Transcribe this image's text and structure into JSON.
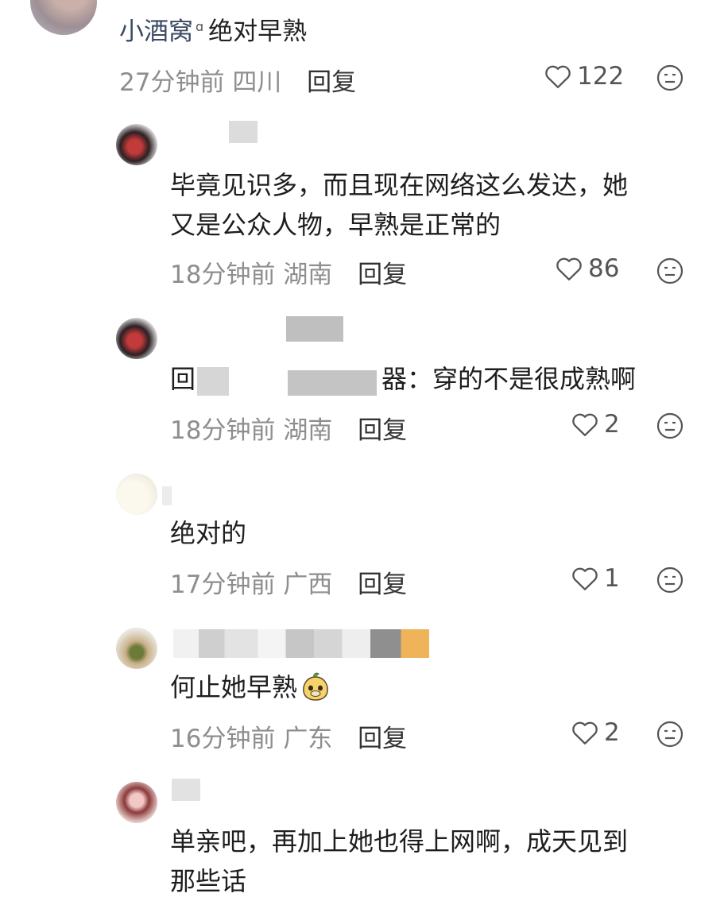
{
  "top_comment": {
    "author": "小酒窝",
    "text": "绝对早熟",
    "time": "27分钟前",
    "location": "四川",
    "reply_label": "回复",
    "likes": "122"
  },
  "replies": [
    {
      "text_line1": "毕竟见识多，而且现在网络这么发达，她",
      "text_line2": "又是公众人物，早熟是正常的",
      "time": "18分钟前",
      "location": "湖南",
      "reply_label": "回复",
      "likes": "86"
    },
    {
      "text_start": "回",
      "text_visible": "器：穿的不是很成熟啊",
      "time": "18分钟前",
      "location": "湖南",
      "reply_label": "回复",
      "likes": "2"
    },
    {
      "text": "绝对的",
      "time": "17分钟前",
      "location": "广西",
      "reply_label": "回复",
      "likes": "1"
    },
    {
      "text": "何止她早熟",
      "time": "16分钟前",
      "location": "广东",
      "reply_label": "回复",
      "likes": "2"
    },
    {
      "text_line1": "单亲吧，再加上她也得上网啊，成天见到",
      "text_line2": "那些话"
    }
  ],
  "icons": {
    "like": "heart-outline-icon",
    "dislike": "neutral-face-icon",
    "sticker": "mango-sticker-icon",
    "author_badge": "author-badge-icon"
  }
}
